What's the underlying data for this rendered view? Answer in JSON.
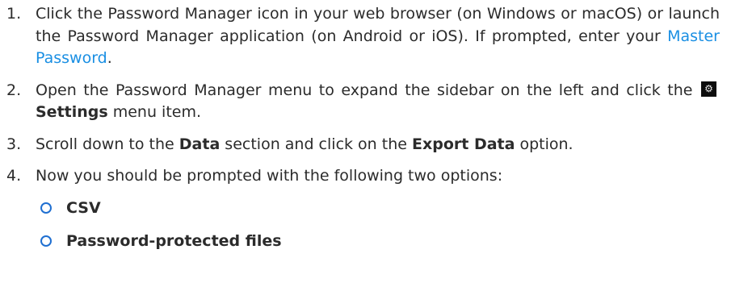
{
  "steps": [
    {
      "num": "1.",
      "pre": "Click the Password Manager icon in your web browser (on Windows or macOS) or launch the Password Manager application (on Android or iOS). If prompted, enter your ",
      "link": "Master Password",
      "post": "."
    },
    {
      "num": "2.",
      "pre": "Open the Password Manager menu to expand the sidebar on the left and click the ",
      "icon": "settings-gear-icon",
      "bold": "Settings",
      "post": " menu item."
    },
    {
      "num": "3.",
      "pre": "Scroll down to the ",
      "bold1": "Data",
      "mid": " section and click on the ",
      "bold2": "Export Data",
      "post": " option."
    },
    {
      "num": "4.",
      "text": "Now you should be prompted with the following two options:"
    }
  ],
  "options": [
    {
      "label": "CSV",
      "icon": "radio-circle-icon"
    },
    {
      "label": "Password-protected files",
      "icon": "radio-circle-icon"
    }
  ],
  "colors": {
    "text": "#2b2b2b",
    "link": "#1a8fe3",
    "bullet": "#1f6fd1"
  }
}
